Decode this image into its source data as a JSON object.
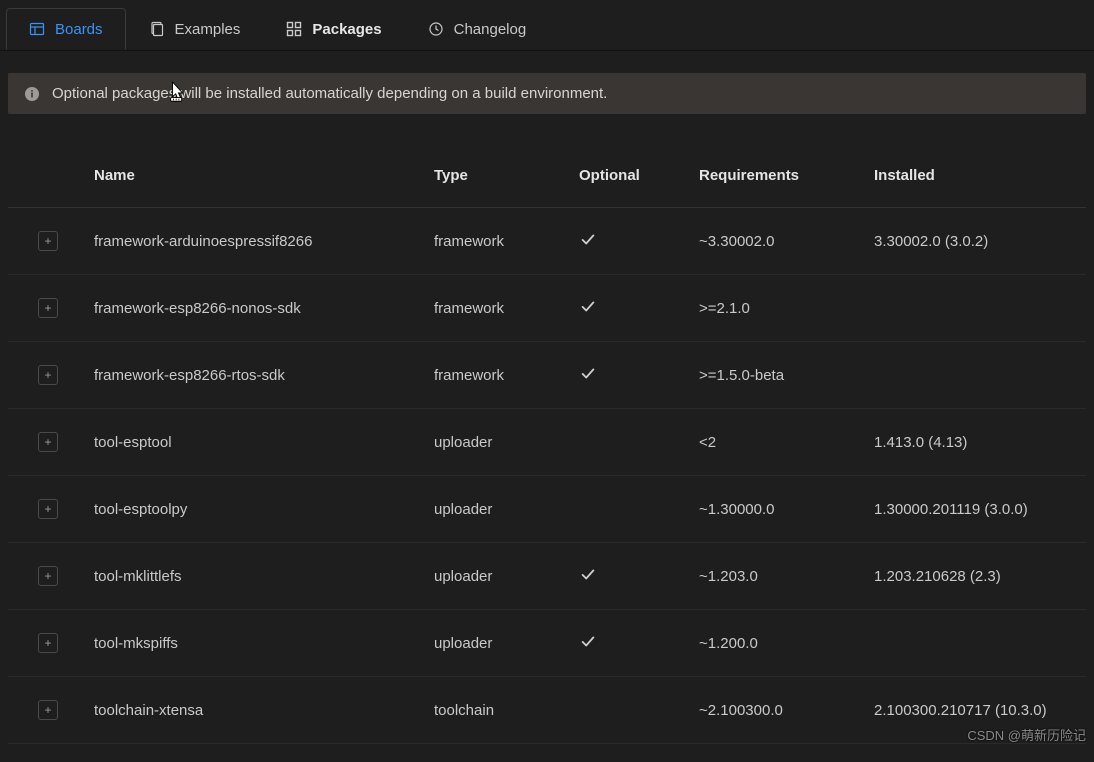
{
  "tabs": {
    "boards": {
      "label": "Boards"
    },
    "examples": {
      "label": "Examples"
    },
    "packages": {
      "label": "Packages"
    },
    "changelog": {
      "label": "Changelog"
    }
  },
  "info": {
    "message": "Optional packages will be installed automatically depending on a build environment."
  },
  "table": {
    "headers": {
      "name": "Name",
      "type": "Type",
      "optional": "Optional",
      "requirements": "Requirements",
      "installed": "Installed"
    },
    "rows": [
      {
        "name": "framework-arduinoespressif8266",
        "type": "framework",
        "optional": true,
        "requirements": "~3.30002.0",
        "installed": "3.30002.0 (3.0.2)"
      },
      {
        "name": "framework-esp8266-nonos-sdk",
        "type": "framework",
        "optional": true,
        "requirements": ">=2.1.0",
        "installed": ""
      },
      {
        "name": "framework-esp8266-rtos-sdk",
        "type": "framework",
        "optional": true,
        "requirements": ">=1.5.0-beta",
        "installed": ""
      },
      {
        "name": "tool-esptool",
        "type": "uploader",
        "optional": false,
        "requirements": "<2",
        "installed": "1.413.0 (4.13)"
      },
      {
        "name": "tool-esptoolpy",
        "type": "uploader",
        "optional": false,
        "requirements": "~1.30000.0",
        "installed": "1.30000.201119 (3.0.0)"
      },
      {
        "name": "tool-mklittlefs",
        "type": "uploader",
        "optional": true,
        "requirements": "~1.203.0",
        "installed": "1.203.210628 (2.3)"
      },
      {
        "name": "tool-mkspiffs",
        "type": "uploader",
        "optional": true,
        "requirements": "~1.200.0",
        "installed": ""
      },
      {
        "name": "toolchain-xtensa",
        "type": "toolchain",
        "optional": false,
        "requirements": "~2.100300.0",
        "installed": "2.100300.210717 (10.3.0)"
      }
    ]
  },
  "watermark": "CSDN @萌新历险记"
}
